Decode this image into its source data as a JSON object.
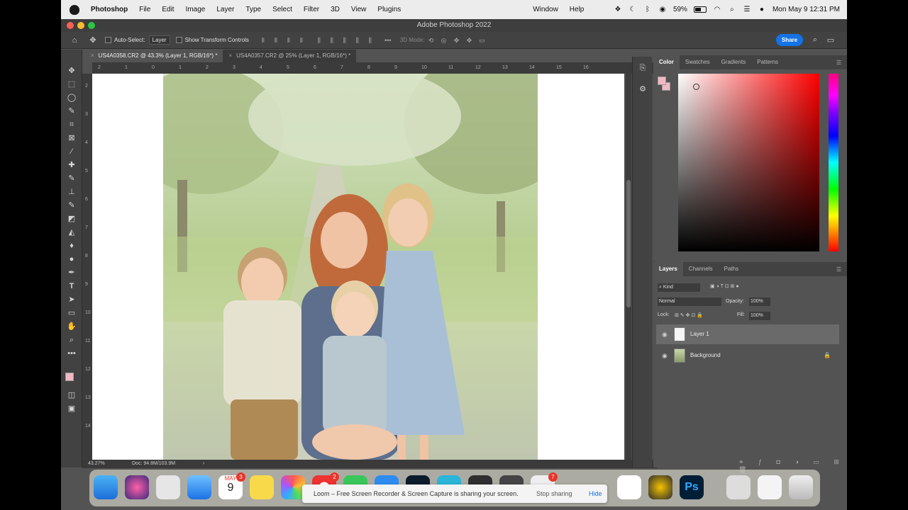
{
  "menubar": {
    "app_name": "Photoshop",
    "items": [
      "File",
      "Edit",
      "Image",
      "Layer",
      "Type",
      "Select",
      "Filter",
      "3D",
      "View",
      "Plugins"
    ],
    "right_items": [
      "Window",
      "Help"
    ],
    "battery_level": 0.59,
    "battery_text": "59%",
    "clock": "Mon May 9  12:31 PM"
  },
  "window": {
    "title": "Adobe Photoshop 2022"
  },
  "options_bar": {
    "auto_select_label": "Auto-Select:",
    "auto_select_value": "Layer",
    "transform_label": "Show Transform Controls",
    "mode_3d": "3D Mode:",
    "share_label": "Share"
  },
  "tabs": [
    {
      "label": "US4A0358.CR2 @ 43.3% (Layer 1, RGB/16*) *",
      "active": true
    },
    {
      "label": "US4A0357.CR2 @ 25% (Layer 1, RGB/16*) *",
      "active": false
    }
  ],
  "ruler": {
    "h_ticks": [
      "2",
      "1",
      "0",
      "1",
      "2",
      "3",
      "4",
      "5",
      "6",
      "7",
      "8",
      "9",
      "10",
      "11",
      "12",
      "13",
      "14",
      "15",
      "16"
    ],
    "v_ticks": [
      "2",
      "3",
      "4",
      "5",
      "6",
      "7",
      "8",
      "9",
      "10",
      "11",
      "12",
      "13",
      "14"
    ]
  },
  "status": {
    "zoom": "43.27%",
    "doc": "Doc: 94.8M/103.9M"
  },
  "color_panel": {
    "tabs": [
      "Color",
      "Swatches",
      "Gradients",
      "Patterns"
    ],
    "foreground": "#f2b8c6",
    "background": "#f2b8c6"
  },
  "layers_panel": {
    "tabs": [
      "Layers",
      "Channels",
      "Paths"
    ],
    "filter": "Kind",
    "blend_mode": "Normal",
    "opacity_label": "Opacity:",
    "opacity_value": "100%",
    "lock_label": "Lock:",
    "fill_label": "Fill:",
    "fill_value": "100%",
    "layers": [
      {
        "name": "Layer 1",
        "selected": true
      },
      {
        "name": "Background",
        "selected": false,
        "locked": true
      }
    ]
  },
  "dock": {
    "calendar_month": "MAY",
    "calendar_day": "9",
    "badges": {
      "calendar": "3",
      "messages": "2",
      "app": "7"
    },
    "photoshop_label": "Ps"
  },
  "loom": {
    "message": "Loom – Free Screen Recorder & Screen Capture is sharing your screen.",
    "stop_label": "Stop sharing",
    "hide_label": "Hide"
  }
}
